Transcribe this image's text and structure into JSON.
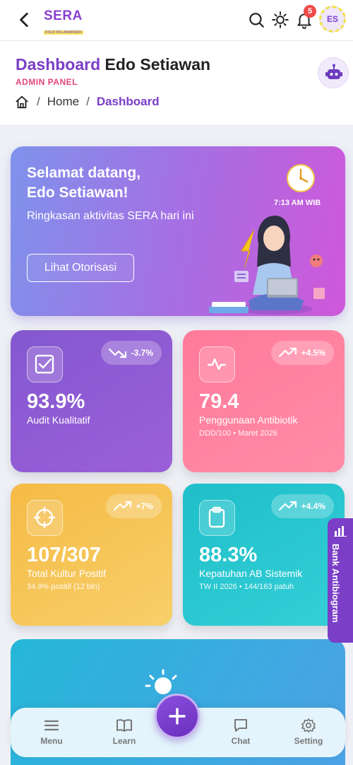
{
  "topbar": {
    "logo_text": "SERA",
    "logo_tagline": "RSUD MULAWARMAN",
    "notification_count": "5",
    "avatar_initials": "ES"
  },
  "header": {
    "title_accent": "Dashboard",
    "title_name": "Edo Setiawan",
    "role": "ADMIN PANEL",
    "breadcrumb": [
      "Home",
      "Dashboard"
    ]
  },
  "welcome": {
    "greeting_line1": "Selamat datang,",
    "greeting_line2": "Edo Setiawan!",
    "subtitle": "Ringkasan aktivitas SERA hari ini",
    "button": "Lihat Otorisasi",
    "time": "7:13 AM WIB"
  },
  "stats": [
    {
      "value": "93.9%",
      "label": "Audit Kualitatif",
      "note": "",
      "change": "-3.7%",
      "trend": "down",
      "icon": "checkbox-icon",
      "color": "#8458cf"
    },
    {
      "value": "79.4",
      "label": "Penggunaan Antibiotik",
      "note": "DDD/100 • Maret 2026",
      "change": "+4.5%",
      "trend": "up",
      "icon": "activity-icon",
      "color": "#ff7a9a"
    },
    {
      "value": "107/307",
      "label": "Total Kultur Positif",
      "note": "34.9% positif (12 bln)",
      "change": "+7%",
      "trend": "up",
      "icon": "crosshair-icon",
      "color": "#f5bb45"
    },
    {
      "value": "88.3%",
      "label": "Kepatuhan AB Sistemik",
      "note": "TW II 2026 • 144/163 patuh",
      "change": "+4.4%",
      "trend": "up",
      "icon": "clipboard-icon",
      "color": "#1ebfc9"
    }
  ],
  "side_tab": {
    "label": "Bank Antibiogram"
  },
  "bottom_nav": {
    "items": [
      {
        "label": "Menu",
        "icon": "menu-icon"
      },
      {
        "label": "Learn",
        "icon": "book-icon"
      },
      {
        "label": "Chat",
        "icon": "chat-icon"
      },
      {
        "label": "Setting",
        "icon": "gear-icon"
      }
    ]
  }
}
